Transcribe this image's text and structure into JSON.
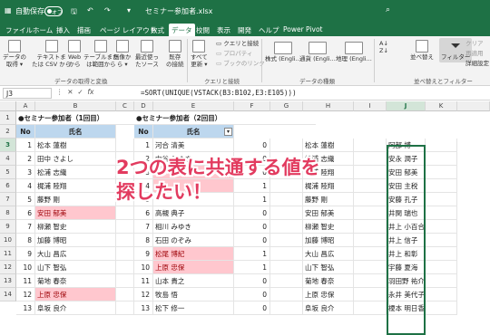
{
  "titlebar": {
    "autosave_label": "自動保存",
    "autosave_state": "オフ",
    "filename": "セミナー参加者.xlsx",
    "search_icon": "search-icon"
  },
  "tabs": [
    "ファイル",
    "ホーム",
    "挿入",
    "描画",
    "ページ レイアウト",
    "数式",
    "データ",
    "校閲",
    "表示",
    "開発",
    "ヘルプ",
    "Power Pivot"
  ],
  "active_tab": "データ",
  "ribbon": {
    "buttons": [
      {
        "label": "データの\n取得 ▾"
      },
      {
        "label": "テキストま\nたは CSV から"
      },
      {
        "label": "Web\nから"
      },
      {
        "label": "テーブルまた\nは範囲から"
      },
      {
        "label": "画像か\nら ▾"
      },
      {
        "label": "最近使っ\nたソース"
      },
      {
        "label": "既存\nの接続"
      },
      {
        "label": "すべて\n更新 ▾"
      }
    ],
    "query_items": [
      "クエリと接続",
      "プロパティ",
      "ブックのリンク"
    ],
    "datatypes": [
      "株式 (Engli...",
      "通貨 (Engli...",
      "地理 (Engli..."
    ],
    "sort_label": "並べ替え",
    "filter_label": "フィルター",
    "small_items": [
      "クリア",
      "再適用",
      "詳細設定"
    ],
    "groups": [
      "データの取得と変換",
      "クエリと接続",
      "データの種類",
      "並べ替えとフィルター"
    ]
  },
  "formula_bar": {
    "name_box": "J3",
    "fx": "fx",
    "formula": "=SORT(UNIQUE(VSTACK(B3:B102,E3:E105)))"
  },
  "columns": [
    "A",
    "B",
    "C",
    "D",
    "E",
    "F",
    "G",
    "H",
    "I",
    "J",
    "K"
  ],
  "rows": [
    "1",
    "2",
    "3",
    "4",
    "5",
    "6",
    "7",
    "8",
    "9",
    "10",
    "11",
    "12",
    "13",
    "14"
  ],
  "table1": {
    "title": "●セミナー参加者（1回目）",
    "no_header": "No",
    "name_header": "氏名",
    "rows": [
      {
        "no": "1",
        "name": "松本 蓮樹"
      },
      {
        "no": "2",
        "name": "田中 さよし"
      },
      {
        "no": "3",
        "name": "松浦 志織"
      },
      {
        "no": "4",
        "name": "梶浦 陸翔"
      },
      {
        "no": "5",
        "name": "藤野 剛"
      },
      {
        "no": "6",
        "name": "安田 郁美"
      },
      {
        "no": "7",
        "name": "柳瀬 智史"
      },
      {
        "no": "8",
        "name": "加藤 博昭"
      },
      {
        "no": "9",
        "name": "大山 昌広"
      },
      {
        "no": "10",
        "name": "山下 智弘"
      },
      {
        "no": "11",
        "name": "菊地 春奈"
      },
      {
        "no": "12",
        "name": "上原 忠保"
      },
      {
        "no": "13",
        "name": "阜坂 良介"
      }
    ]
  },
  "table2": {
    "title": "●セミナー参加者（2回目）",
    "no_header": "No",
    "name_header": "氏名",
    "rows": [
      {
        "no": "1",
        "name": "河合 清美",
        "f": "0",
        "h": "松本 蓮樹"
      },
      {
        "no": "2",
        "name": "中谷 みゆき",
        "f": "0",
        "h": "松浦 志織"
      },
      {
        "no": "3",
        "name": "",
        "f": "0",
        "h": "梶浦 陸翔"
      },
      {
        "no": "4",
        "name": "",
        "f": "1",
        "h": "梶浦 陸翔"
      },
      {
        "no": "5",
        "name": "",
        "f": "1",
        "h": "藤野 剛"
      },
      {
        "no": "6",
        "name": "高槻 典子",
        "f": "0",
        "h": "安田 郁美"
      },
      {
        "no": "7",
        "name": "相川 みゆき",
        "f": "0",
        "h": "柳瀬 智史"
      },
      {
        "no": "8",
        "name": "石田 のぞみ",
        "f": "0",
        "h": "加藤 博昭"
      },
      {
        "no": "9",
        "name": "松尾 博紀",
        "f": "1",
        "h": "大山 昌広"
      },
      {
        "no": "10",
        "name": "上原 忠保",
        "f": "1",
        "h": "山下 智弘"
      },
      {
        "no": "11",
        "name": "山本 貴之",
        "f": "0",
        "h": "菊地 春奈"
      },
      {
        "no": "12",
        "name": "牧島 悟",
        "f": "0",
        "h": "上原 忠保"
      },
      {
        "no": "13",
        "name": "松下 修一",
        "f": "0",
        "h": "阜坂 良介"
      }
    ]
  },
  "col_j": [
    "阿部 博",
    "安永 潤子",
    "安田 郁美",
    "安田 主税",
    "安藤 孔子",
    "井関 瑞也",
    "井上 小百合",
    "井上 信子",
    "井上 和彰",
    "宇藤 夏海",
    "羽田野 祐介",
    "永井 美代子",
    "榎本 明日香"
  ],
  "callout": [
    "2つの表に共通する値を",
    "探したい！"
  ],
  "colors": {
    "accent": "#1e7145",
    "header_fill": "#bdd7ee",
    "pink_fill": "#ffc7ce",
    "pink_text": "#9c0006",
    "callout": "#e23b5f"
  }
}
